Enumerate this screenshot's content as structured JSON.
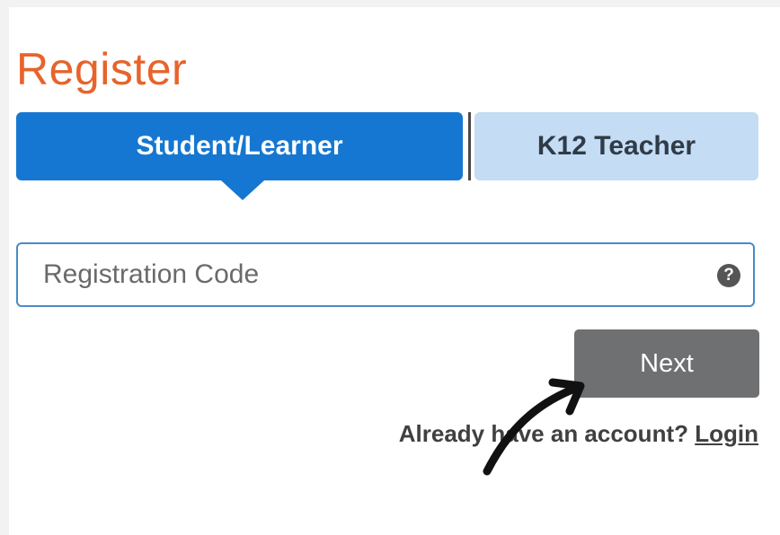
{
  "page": {
    "title": "Register"
  },
  "tabs": [
    {
      "label": "Student/Learner",
      "active": true
    },
    {
      "label": "K12 Teacher",
      "active": false
    }
  ],
  "registration": {
    "placeholder": "Registration Code",
    "value": "",
    "help_icon": "question-circle-icon",
    "help_glyph": "?"
  },
  "actions": {
    "next_label": "Next"
  },
  "account": {
    "prompt": "Already have an account?",
    "login_label": "Login"
  },
  "annotation": {
    "icon": "curved-arrow-icon"
  },
  "colors": {
    "title": "#e8632b",
    "tab_active": "#1577d1",
    "tab_inactive": "#c4dcf4",
    "input_border": "#4a8ac9",
    "next_button": "#6f7071"
  }
}
